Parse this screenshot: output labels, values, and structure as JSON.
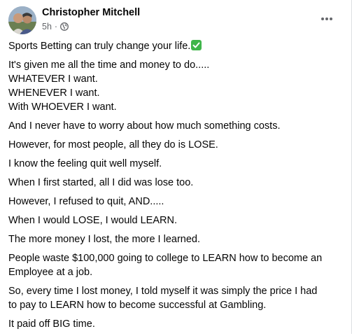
{
  "post": {
    "author": "Christopher Mitchell",
    "time": "5h",
    "separator": "·",
    "privacy_icon": "globe-icon",
    "more_icon": "more-options-icon",
    "paragraphs": [
      {
        "lines": [
          "Sports Betting can truly change your life."
        ],
        "emoji": "check-mark-icon"
      },
      {
        "lines": [
          "It's given me all the time and money to do.....",
          "WHATEVER I want.",
          "WHENEVER I want.",
          "With WHOEVER I want."
        ]
      },
      {
        "lines": [
          "And I never have to worry about how much something costs."
        ]
      },
      {
        "lines": [
          "However, for most people, all they do is LOSE."
        ]
      },
      {
        "lines": [
          "I know the feeling quit well myself."
        ]
      },
      {
        "lines": [
          "When I first started, all I did was lose too."
        ]
      },
      {
        "lines": [
          "However, I refused to quit, AND....."
        ]
      },
      {
        "lines": [
          "When I would LOSE, I would LEARN."
        ]
      },
      {
        "lines": [
          "The more money I lost, the more I learned."
        ]
      },
      {
        "lines": [
          "People waste $100,000 going to college to LEARN how to become an",
          "Employee at a job."
        ]
      },
      {
        "lines": [
          "So, every time I lost money, I told myself it was simply the price I had",
          "to pay to LEARN how to become successful at Gambling."
        ]
      },
      {
        "lines": [
          "It paid off BIG time."
        ]
      }
    ]
  }
}
